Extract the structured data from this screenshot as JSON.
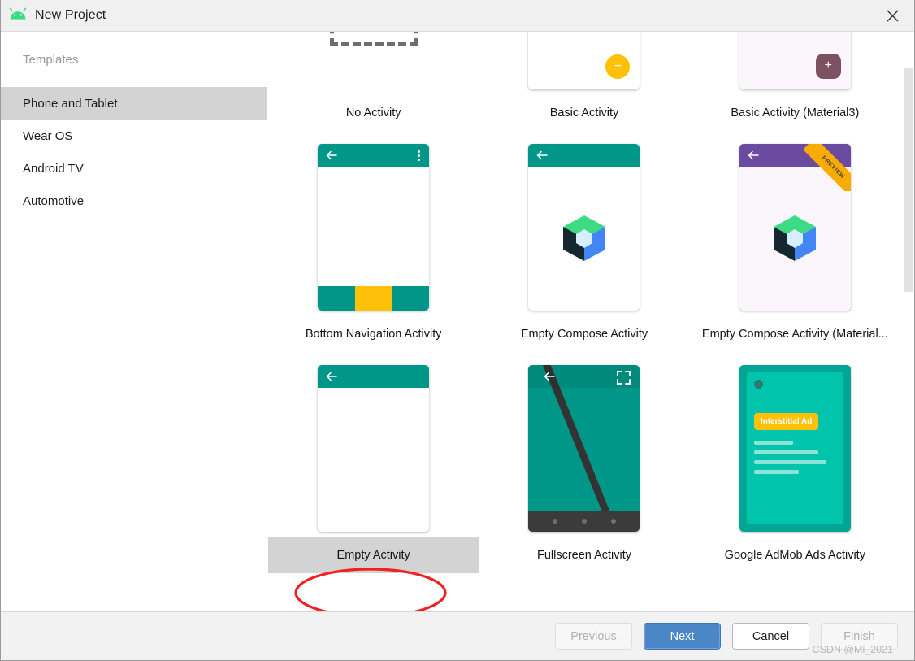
{
  "window": {
    "title": "New Project",
    "icon": "android-head-icon",
    "close_icon": "close-icon"
  },
  "sidebar": {
    "header": "Templates",
    "items": [
      {
        "label": "Phone and Tablet",
        "selected": true
      },
      {
        "label": "Wear OS",
        "selected": false
      },
      {
        "label": "Android TV",
        "selected": false
      },
      {
        "label": "Automotive",
        "selected": false
      }
    ]
  },
  "templates": {
    "selected": "Empty Activity",
    "items": [
      {
        "label": "No Activity",
        "art": "dashed-rect",
        "badge": ""
      },
      {
        "label": "Basic Activity",
        "art": "phone-fab",
        "badge": ""
      },
      {
        "label": "Basic Activity (Material3)",
        "art": "phone-fab-m3",
        "badge": ""
      },
      {
        "label": "Bottom Navigation Activity",
        "art": "phone-bottomnav",
        "badge": ""
      },
      {
        "label": "Empty Compose Activity",
        "art": "phone-compose",
        "badge": ""
      },
      {
        "label": "Empty Compose Activity (Material...",
        "art": "phone-compose-m3",
        "badge": "PREVIEW"
      },
      {
        "label": "Empty Activity",
        "art": "phone-plain",
        "badge": ""
      },
      {
        "label": "Fullscreen Activity",
        "art": "phone-fullscreen",
        "badge": ""
      },
      {
        "label": "Google AdMob Ads Activity",
        "art": "phone-admob",
        "badge": ""
      }
    ],
    "admob_chip_label": "Interstitial Ad"
  },
  "footer": {
    "previous": {
      "label": "Previous",
      "enabled": false
    },
    "next": {
      "label": "Next",
      "mnemonic": "N",
      "enabled": true,
      "primary": true
    },
    "cancel": {
      "label": "Cancel",
      "mnemonic": "C",
      "enabled": true
    },
    "finish": {
      "label": "Finish",
      "enabled": false
    },
    "watermark": "CSDN @Mi_2021"
  },
  "colors": {
    "accent_teal": "#009688",
    "accent_amber": "#ffc107",
    "accent_purple": "#6a4ba0",
    "accent_m3": "#7d5260",
    "primary_button": "#4a86c8",
    "selection_grey": "#d3d3d3",
    "annotation_red": "#ee2222",
    "admob_teal": "#00c4ab"
  },
  "annotation": {
    "shape": "ellipse",
    "target": "Empty Activity",
    "color": "#ee2222"
  },
  "scroll": {
    "orientation": "vertical",
    "thumb_position_pct": 22
  }
}
